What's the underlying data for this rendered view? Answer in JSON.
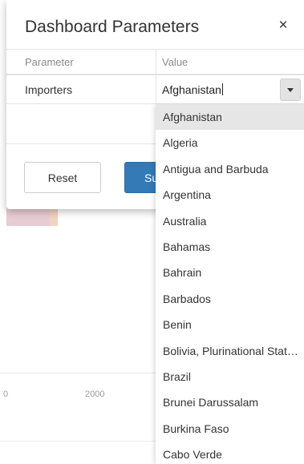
{
  "modal": {
    "title": "Dashboard Parameters",
    "close_glyph": "×"
  },
  "table": {
    "headers": {
      "parameter": "Parameter",
      "value": "Value"
    },
    "row": {
      "parameter": "Importers",
      "value": "Afghanistan"
    }
  },
  "buttons": {
    "reset_label": "Reset",
    "submit_label": "Submit"
  },
  "dropdown": {
    "selected": "Afghanistan",
    "options": [
      "Afghanistan",
      "Algeria",
      "Antigua and Barbuda",
      "Argentina",
      "Australia",
      "Bahamas",
      "Bahrain",
      "Barbados",
      "Benin",
      "Bolivia, Plurinational State of",
      "Brazil",
      "Brunei Darussalam",
      "Burkina Faso",
      "Cabo Verde"
    ]
  },
  "background": {
    "axis_ticks": [
      "0",
      "2000"
    ]
  },
  "colors": {
    "primary_button": "#337ab7",
    "selected_option": "#e6e6e6"
  }
}
